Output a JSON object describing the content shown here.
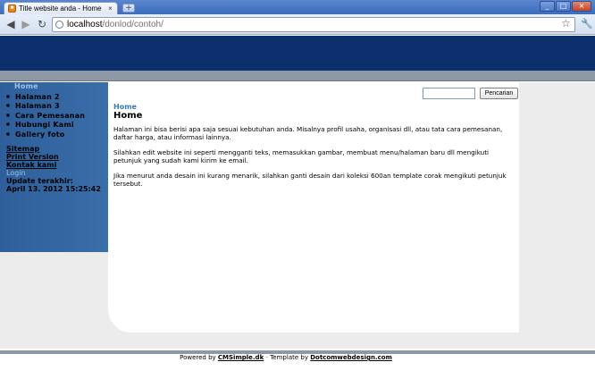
{
  "browser": {
    "tab_title": "Title website anda - Home",
    "favicon": "cms-favicon",
    "new_tab": "+",
    "win_min": "_",
    "win_max": "□",
    "win_close": "×",
    "tab_close": "×",
    "url_host": "localhost",
    "url_path": "/donlod/contoh/",
    "icons": {
      "back": "◀",
      "forward": "▶",
      "reload": "↻",
      "star": "☆",
      "wrench": "🔧"
    }
  },
  "sidebar": {
    "active_item": "Home",
    "items": [
      {
        "label": "Halaman 2"
      },
      {
        "label": "Halaman 3"
      },
      {
        "label": "Cara Pemesanan"
      },
      {
        "label": "Hubungi Kami"
      },
      {
        "label": "Gallery foto"
      }
    ],
    "links": {
      "sitemap": "Sitemap",
      "print": "Print Version",
      "contact": "Kontak kami",
      "login": "Login"
    },
    "update_label": "Update terakhir:",
    "update_value": "April 13. 2012 15:25:42"
  },
  "search": {
    "value": "",
    "button": "Pencarian"
  },
  "content": {
    "breadcrumb": "Home",
    "title": "Home",
    "paragraphs": [
      "Halaman ini bisa berisi apa saja sesuai kebutuhan anda. Misalnya profil usaha, organisasi dll, atau tata cara pemesanan, daftar harga, atau informasi lainnya.",
      "Silahkan edit website ini seperti mengganti teks, memasukkan gambar, membuat menu/halaman baru dll mengikuti petunjuk yang sudah kami kirim ke email.",
      "Jika menurut anda desain ini kurang menarik, silahkan ganti desain dari koleksi 600an template corak mengikuti petunjuk tersebut."
    ]
  },
  "footer": {
    "powered_prefix": "Powered by ",
    "powered_link": "CMSimple.dk",
    "separator": " - ",
    "template_prefix": "Template by ",
    "template_link": "Dotcomwebdesign.com"
  },
  "colors": {
    "header": "#0c2f6d",
    "sidebar": "#3367a3",
    "accent": "#3a7ab8",
    "page_bg": "#ececec"
  }
}
